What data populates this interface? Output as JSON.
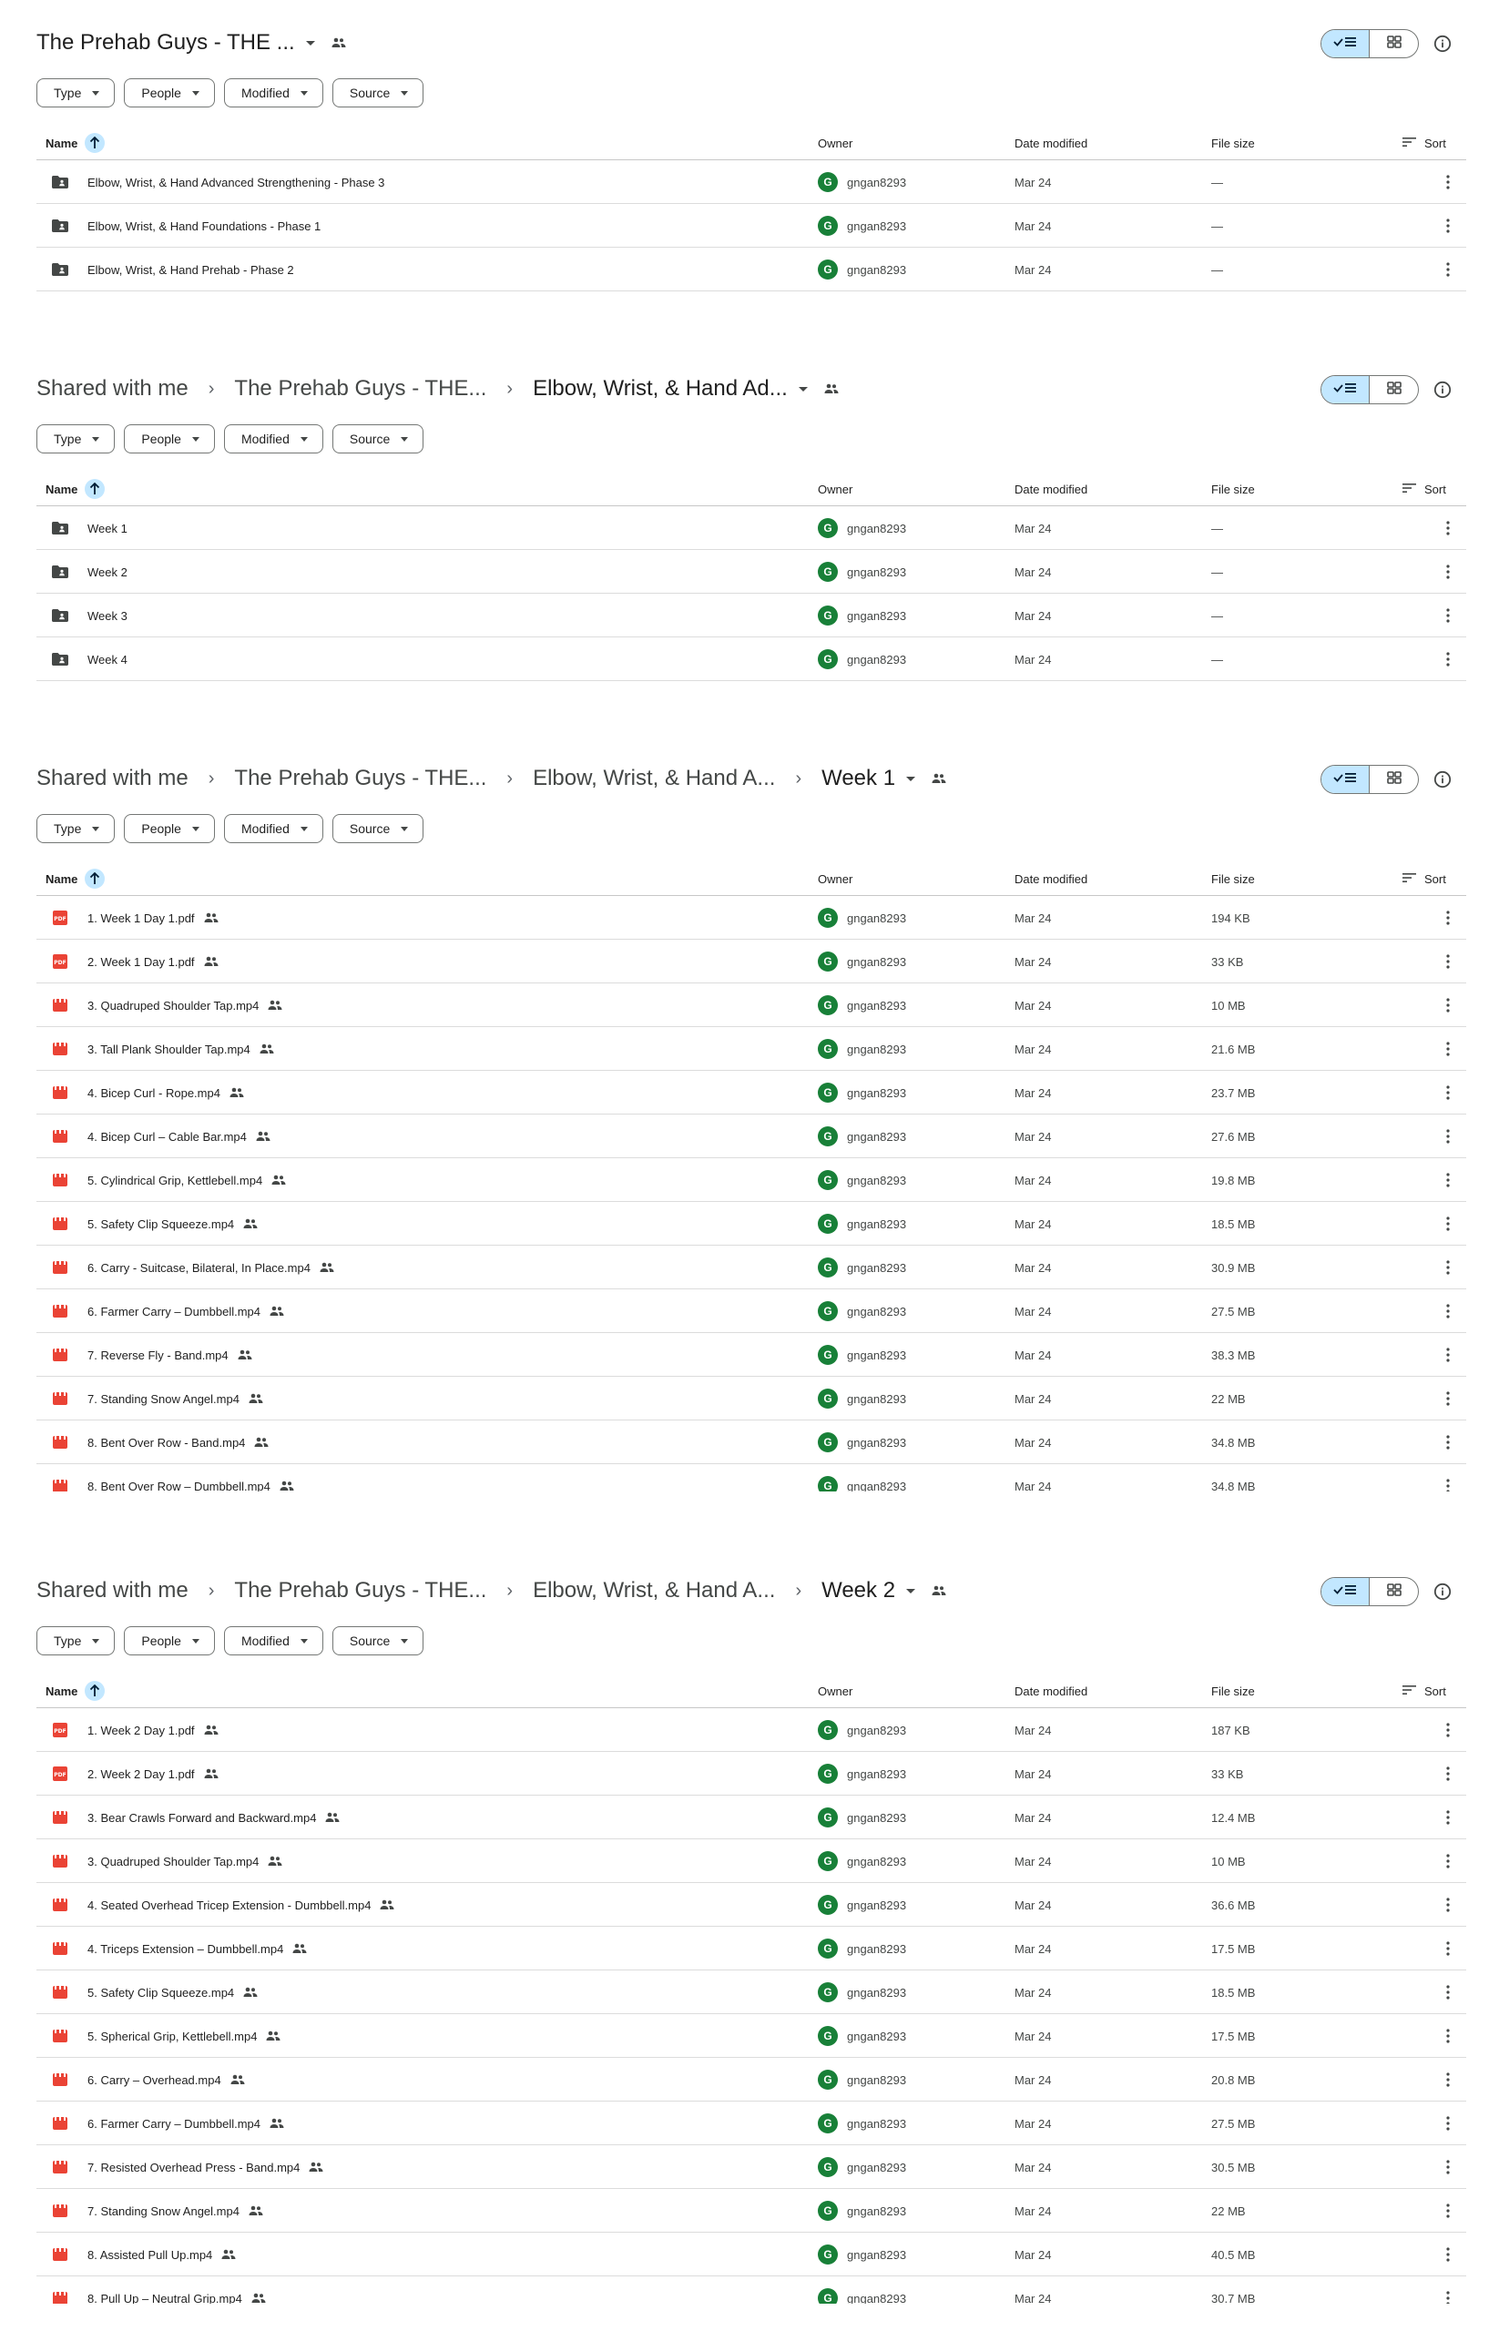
{
  "colors": {
    "accent": "#c2e7ff",
    "owner_avatar": "#188038",
    "pdf_icon": "#ea4335",
    "video_icon": "#ea4335",
    "folder_icon": "#444746"
  },
  "icons": {
    "list_view": "check-list-icon",
    "grid_view": "grid-icon",
    "info": "info-icon",
    "shared": "people-icon",
    "more": "more-vertical-icon",
    "sort": "sort-lines-icon",
    "sort_direction": "arrow-up-icon"
  },
  "common": {
    "filters": {
      "type": "Type",
      "people": "People",
      "modified": "Modified",
      "source": "Source"
    },
    "columns": {
      "name": "Name",
      "owner": "Owner",
      "date_modified": "Date modified",
      "file_size": "File size",
      "sort": "Sort"
    },
    "avatar_letter": "G"
  },
  "panels": [
    {
      "breadcrumb": [
        "The Prehab Guys - THE ..."
      ],
      "rows": [
        {
          "type": "folder",
          "name": "Elbow, Wrist, & Hand Advanced Strengthening - Phase 3",
          "owner": "gngan8293",
          "date": "Mar 24",
          "size": "—"
        },
        {
          "type": "folder",
          "name": "Elbow, Wrist, & Hand Foundations - Phase 1",
          "owner": "gngan8293",
          "date": "Mar 24",
          "size": "—"
        },
        {
          "type": "folder",
          "name": "Elbow, Wrist, & Hand Prehab - Phase 2",
          "owner": "gngan8293",
          "date": "Mar 24",
          "size": "—"
        }
      ]
    },
    {
      "breadcrumb": [
        "Shared with me",
        "The Prehab Guys - THE...",
        "Elbow, Wrist, & Hand Ad..."
      ],
      "rows": [
        {
          "type": "folder",
          "name": "Week 1",
          "owner": "gngan8293",
          "date": "Mar 24",
          "size": "—"
        },
        {
          "type": "folder",
          "name": "Week 2",
          "owner": "gngan8293",
          "date": "Mar 24",
          "size": "—"
        },
        {
          "type": "folder",
          "name": "Week 3",
          "owner": "gngan8293",
          "date": "Mar 24",
          "size": "—"
        },
        {
          "type": "folder",
          "name": "Week 4",
          "owner": "gngan8293",
          "date": "Mar 24",
          "size": "—"
        }
      ]
    },
    {
      "breadcrumb": [
        "Shared with me",
        "The Prehab Guys - THE...",
        "Elbow, Wrist, & Hand A...",
        "Week 1"
      ],
      "rows": [
        {
          "type": "pdf",
          "name": "1. Week 1 Day 1.pdf",
          "owner": "gngan8293",
          "date": "Mar 24",
          "size": "194 KB"
        },
        {
          "type": "pdf",
          "name": "2. Week 1 Day 1.pdf",
          "owner": "gngan8293",
          "date": "Mar 24",
          "size": "33 KB"
        },
        {
          "type": "video",
          "name": "3. Quadruped Shoulder Tap.mp4",
          "owner": "gngan8293",
          "date": "Mar 24",
          "size": "10 MB"
        },
        {
          "type": "video",
          "name": "3. Tall Plank Shoulder Tap.mp4",
          "owner": "gngan8293",
          "date": "Mar 24",
          "size": "21.6 MB"
        },
        {
          "type": "video",
          "name": "4. Bicep Curl - Rope.mp4",
          "owner": "gngan8293",
          "date": "Mar 24",
          "size": "23.7 MB"
        },
        {
          "type": "video",
          "name": "4. Bicep Curl – Cable Bar.mp4",
          "owner": "gngan8293",
          "date": "Mar 24",
          "size": "27.6 MB"
        },
        {
          "type": "video",
          "name": "5. Cylindrical Grip, Kettlebell.mp4",
          "owner": "gngan8293",
          "date": "Mar 24",
          "size": "19.8 MB"
        },
        {
          "type": "video",
          "name": "5. Safety Clip Squeeze.mp4",
          "owner": "gngan8293",
          "date": "Mar 24",
          "size": "18.5 MB"
        },
        {
          "type": "video",
          "name": "6. Carry - Suitcase, Bilateral, In Place.mp4",
          "owner": "gngan8293",
          "date": "Mar 24",
          "size": "30.9 MB"
        },
        {
          "type": "video",
          "name": "6. Farmer Carry – Dumbbell.mp4",
          "owner": "gngan8293",
          "date": "Mar 24",
          "size": "27.5 MB"
        },
        {
          "type": "video",
          "name": "7. Reverse Fly - Band.mp4",
          "owner": "gngan8293",
          "date": "Mar 24",
          "size": "38.3 MB"
        },
        {
          "type": "video",
          "name": "7. Standing Snow Angel.mp4",
          "owner": "gngan8293",
          "date": "Mar 24",
          "size": "22 MB"
        },
        {
          "type": "video",
          "name": "8. Bent Over Row - Band.mp4",
          "owner": "gngan8293",
          "date": "Mar 24",
          "size": "34.8 MB"
        },
        {
          "type": "video",
          "name": "8. Bent Over Row – Dumbbell.mp4",
          "owner": "gngan8293",
          "date": "Mar 24",
          "size": "34.8 MB"
        }
      ]
    },
    {
      "breadcrumb": [
        "Shared with me",
        "The Prehab Guys - THE...",
        "Elbow, Wrist, & Hand A...",
        "Week 2"
      ],
      "rows": [
        {
          "type": "pdf",
          "name": "1. Week 2 Day 1.pdf",
          "owner": "gngan8293",
          "date": "Mar 24",
          "size": "187 KB"
        },
        {
          "type": "pdf",
          "name": "2. Week 2 Day 1.pdf",
          "owner": "gngan8293",
          "date": "Mar 24",
          "size": "33 KB"
        },
        {
          "type": "video",
          "name": "3. Bear Crawls Forward and Backward.mp4",
          "owner": "gngan8293",
          "date": "Mar 24",
          "size": "12.4 MB"
        },
        {
          "type": "video",
          "name": "3. Quadruped Shoulder Tap.mp4",
          "owner": "gngan8293",
          "date": "Mar 24",
          "size": "10 MB"
        },
        {
          "type": "video",
          "name": "4. Seated Overhead Tricep Extension - Dumbbell.mp4",
          "owner": "gngan8293",
          "date": "Mar 24",
          "size": "36.6 MB"
        },
        {
          "type": "video",
          "name": "4. Triceps Extension – Dumbbell.mp4",
          "owner": "gngan8293",
          "date": "Mar 24",
          "size": "17.5 MB"
        },
        {
          "type": "video",
          "name": "5. Safety Clip Squeeze.mp4",
          "owner": "gngan8293",
          "date": "Mar 24",
          "size": "18.5 MB"
        },
        {
          "type": "video",
          "name": "5. Spherical Grip, Kettlebell.mp4",
          "owner": "gngan8293",
          "date": "Mar 24",
          "size": "17.5 MB"
        },
        {
          "type": "video",
          "name": "6. Carry – Overhead.mp4",
          "owner": "gngan8293",
          "date": "Mar 24",
          "size": "20.8 MB"
        },
        {
          "type": "video",
          "name": "6. Farmer Carry – Dumbbell.mp4",
          "owner": "gngan8293",
          "date": "Mar 24",
          "size": "27.5 MB"
        },
        {
          "type": "video",
          "name": "7. Resisted Overhead Press - Band.mp4",
          "owner": "gngan8293",
          "date": "Mar 24",
          "size": "30.5 MB"
        },
        {
          "type": "video",
          "name": "7. Standing Snow Angel.mp4",
          "owner": "gngan8293",
          "date": "Mar 24",
          "size": "22 MB"
        },
        {
          "type": "video",
          "name": "8. Assisted Pull Up.mp4",
          "owner": "gngan8293",
          "date": "Mar 24",
          "size": "40.5 MB"
        },
        {
          "type": "video",
          "name": "8. Pull Up – Neutral Grip.mp4",
          "owner": "gngan8293",
          "date": "Mar 24",
          "size": "30.7 MB"
        }
      ]
    }
  ]
}
